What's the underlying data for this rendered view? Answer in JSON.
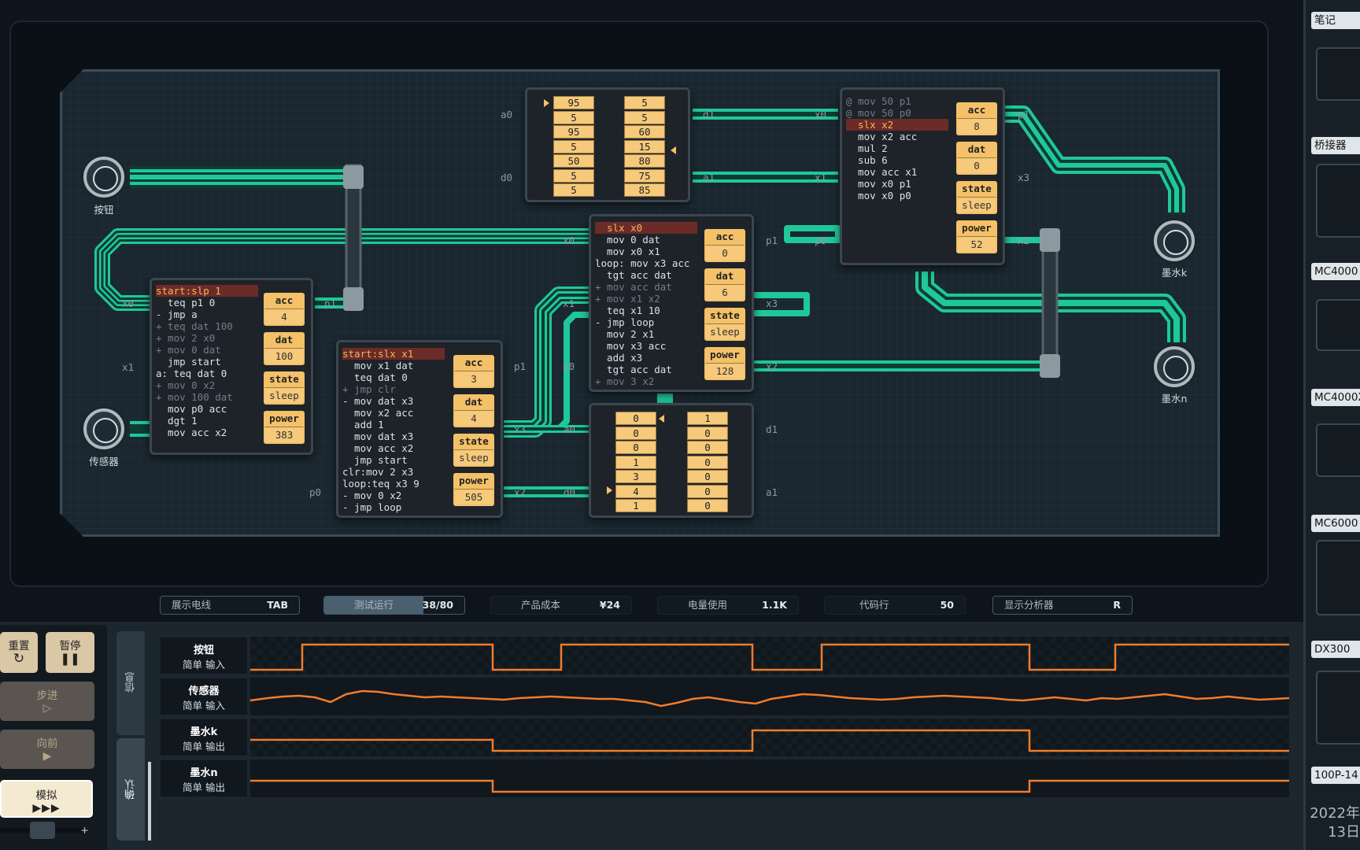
{
  "io": {
    "button": "按钮",
    "sensor": "传感器",
    "ink_k": "墨水k",
    "ink_n": "墨水n"
  },
  "chip_a": {
    "code": [
      {
        "t": "start:slp 1",
        "s": "cur"
      },
      {
        "t": "  teq p1 0",
        "s": ""
      },
      {
        "t": "- jmp a",
        "s": ""
      },
      {
        "t": "+ teq dat 100",
        "s": "dim"
      },
      {
        "t": "+ mov 2 x0",
        "s": "dim"
      },
      {
        "t": "+ mov 0 dat",
        "s": "dim"
      },
      {
        "t": "  jmp start",
        "s": ""
      },
      {
        "t": "a: teq dat 0",
        "s": ""
      },
      {
        "t": "+ mov 0 x2",
        "s": "dim"
      },
      {
        "t": "+ mov 100 dat",
        "s": "dim"
      },
      {
        "t": "  mov p0 acc",
        "s": ""
      },
      {
        "t": "  dgt 1",
        "s": ""
      },
      {
        "t": "  mov acc x2",
        "s": ""
      }
    ],
    "regs": [
      {
        "n": "acc",
        "v": "4"
      },
      {
        "n": "dat",
        "v": "100"
      },
      {
        "n": "state",
        "v": "sleep"
      },
      {
        "n": "power",
        "v": "383"
      }
    ],
    "pins": {
      "x0": "x0",
      "x1": "x1",
      "p1": "p1"
    }
  },
  "chip_b": {
    "code": [
      {
        "t": "start:slx x1",
        "s": "cur"
      },
      {
        "t": "  mov x1 dat",
        "s": ""
      },
      {
        "t": "  teq dat 0",
        "s": ""
      },
      {
        "t": "+ jmp clr",
        "s": "dim"
      },
      {
        "t": "- mov dat x3",
        "s": ""
      },
      {
        "t": "  mov x2 acc",
        "s": ""
      },
      {
        "t": "  add 1",
        "s": ""
      },
      {
        "t": "  mov dat x3",
        "s": ""
      },
      {
        "t": "  mov acc x2",
        "s": ""
      },
      {
        "t": "  jmp start",
        "s": ""
      },
      {
        "t": "clr:mov 2 x3",
        "s": ""
      },
      {
        "t": "loop:teq x3 9",
        "s": ""
      },
      {
        "t": "- mov 0 x2",
        "s": ""
      },
      {
        "t": "- jmp loop",
        "s": ""
      }
    ],
    "regs": [
      {
        "n": "acc",
        "v": "3"
      },
      {
        "n": "dat",
        "v": "4"
      },
      {
        "n": "state",
        "v": "sleep"
      },
      {
        "n": "power",
        "v": "505"
      }
    ],
    "pins": {
      "p1": "p1",
      "p0": "p0",
      "x3": "x3",
      "x2": "x2"
    }
  },
  "chip_c": {
    "code": [
      {
        "t": "  slx x0",
        "s": "cur"
      },
      {
        "t": "  mov 0 dat",
        "s": ""
      },
      {
        "t": "  mov x0 x1",
        "s": ""
      },
      {
        "t": "loop: mov x3 acc",
        "s": ""
      },
      {
        "t": "  tgt acc dat",
        "s": ""
      },
      {
        "t": "+ mov acc dat",
        "s": "dim"
      },
      {
        "t": "+ mov x1 x2",
        "s": "dim"
      },
      {
        "t": "  teq x1 10",
        "s": ""
      },
      {
        "t": "- jmp loop",
        "s": ""
      },
      {
        "t": "  mov 2 x1",
        "s": ""
      },
      {
        "t": "  mov x3 acc",
        "s": ""
      },
      {
        "t": "  add x3",
        "s": ""
      },
      {
        "t": "  tgt acc dat",
        "s": ""
      },
      {
        "t": "+ mov 3 x2",
        "s": "dim"
      }
    ],
    "regs": [
      {
        "n": "acc",
        "v": "0"
      },
      {
        "n": "dat",
        "v": "6"
      },
      {
        "n": "state",
        "v": "sleep"
      },
      {
        "n": "power",
        "v": "128"
      }
    ],
    "pins": {
      "x0": "x0",
      "x1": "x1",
      "p1": "p1",
      "p0": "p0",
      "x3": "x3",
      "x2": "x2"
    }
  },
  "chip_d": {
    "code": [
      {
        "t": "@ mov 50 p1",
        "s": "dim"
      },
      {
        "t": "@ mov 50 p0",
        "s": "dim"
      },
      {
        "t": "  slx x2",
        "s": "cur"
      },
      {
        "t": "  mov x2 acc",
        "s": ""
      },
      {
        "t": "  mul 2",
        "s": ""
      },
      {
        "t": "  sub 6",
        "s": ""
      },
      {
        "t": "  mov acc x1",
        "s": ""
      },
      {
        "t": "  mov x0 p1",
        "s": ""
      },
      {
        "t": "  mov x0 p0",
        "s": ""
      }
    ],
    "regs": [
      {
        "n": "acc",
        "v": "8"
      },
      {
        "n": "dat",
        "v": "0"
      },
      {
        "n": "state",
        "v": "sleep"
      },
      {
        "n": "power",
        "v": "52"
      }
    ],
    "pins": {
      "x0": "x0",
      "x1": "x1",
      "p1": "p1",
      "x3": "x3",
      "x2": "x2",
      "p0": "p0"
    }
  },
  "rom_top": {
    "col1": [
      "95",
      "5",
      "95",
      "5",
      "50",
      "5",
      "5"
    ],
    "col2": [
      "5",
      "5",
      "60",
      "15",
      "80",
      "75",
      "85"
    ],
    "pins": {
      "a0": "a0",
      "d0": "d0",
      "d1": "d1",
      "a1": "a1"
    }
  },
  "rom_bottom": {
    "col1": [
      "0",
      "0",
      "0",
      "1",
      "3",
      "4",
      "1"
    ],
    "col2": [
      "1",
      "0",
      "0",
      "0",
      "0",
      "0",
      "0"
    ],
    "pins": {
      "a0": "a0",
      "d0": "d0",
      "d1": "d1",
      "a1": "a1"
    }
  },
  "status": {
    "wires": {
      "label": "展示电线",
      "key": "TAB"
    },
    "test": {
      "label": "测试运行",
      "value": "38/80"
    },
    "cost": {
      "label": "产品成本",
      "value": "¥24"
    },
    "power": {
      "label": "电量使用",
      "value": "1.1K"
    },
    "lines": {
      "label": "代码行",
      "value": "50"
    },
    "analyzer": {
      "label": "显示分析器",
      "key": "R"
    }
  },
  "controls": {
    "reset": "重置",
    "pause": "暂停",
    "step": "步进",
    "advance": "向前",
    "simulate": "模拟",
    "tab_info": "信息",
    "tab_verify": "确认"
  },
  "traces": [
    {
      "name": "按钮",
      "type": "简单 输入"
    },
    {
      "name": "传感器",
      "type": "简单 输入"
    },
    {
      "name": "墨水k",
      "type": "简单 输出"
    },
    {
      "name": "墨水n",
      "type": "简单 输出"
    }
  ],
  "sidebar": {
    "notes": "笔记",
    "bridge": "桥接器",
    "mc4000": "MC4000",
    "mc4000x": "MC4000X",
    "mc6000": "MC6000",
    "dx300": "DX300",
    "p14": "100P-14",
    "date1": "2022年",
    "date2": "13日"
  },
  "colors": {
    "accent": "#f4c168",
    "wire": "#1fc89a",
    "trace": "#f07c2a"
  }
}
